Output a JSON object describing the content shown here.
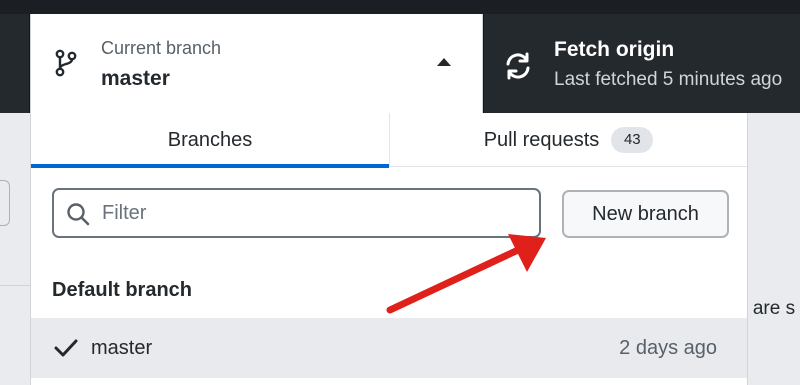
{
  "toolbar": {
    "current_branch": {
      "label": "Current branch",
      "value": "master",
      "icon": "git-branch-icon"
    },
    "fetch": {
      "title": "Fetch origin",
      "subtitle": "Last fetched 5 minutes ago",
      "icon": "sync-icon"
    }
  },
  "dropdown": {
    "tabs": [
      {
        "label": "Branches",
        "active": true
      },
      {
        "label": "Pull requests",
        "count": "43",
        "active": false
      }
    ],
    "filter": {
      "placeholder": "Filter",
      "value": ""
    },
    "new_branch_label": "New branch",
    "section_header": "Default branch",
    "branches": [
      {
        "name": "master",
        "time": "2 days ago",
        "checked": true
      }
    ]
  },
  "background": {
    "right_text": "e are s"
  },
  "colors": {
    "toolbar_bg": "#24292e",
    "accent": "#0366d6",
    "annotation_arrow": "#e0201b"
  }
}
